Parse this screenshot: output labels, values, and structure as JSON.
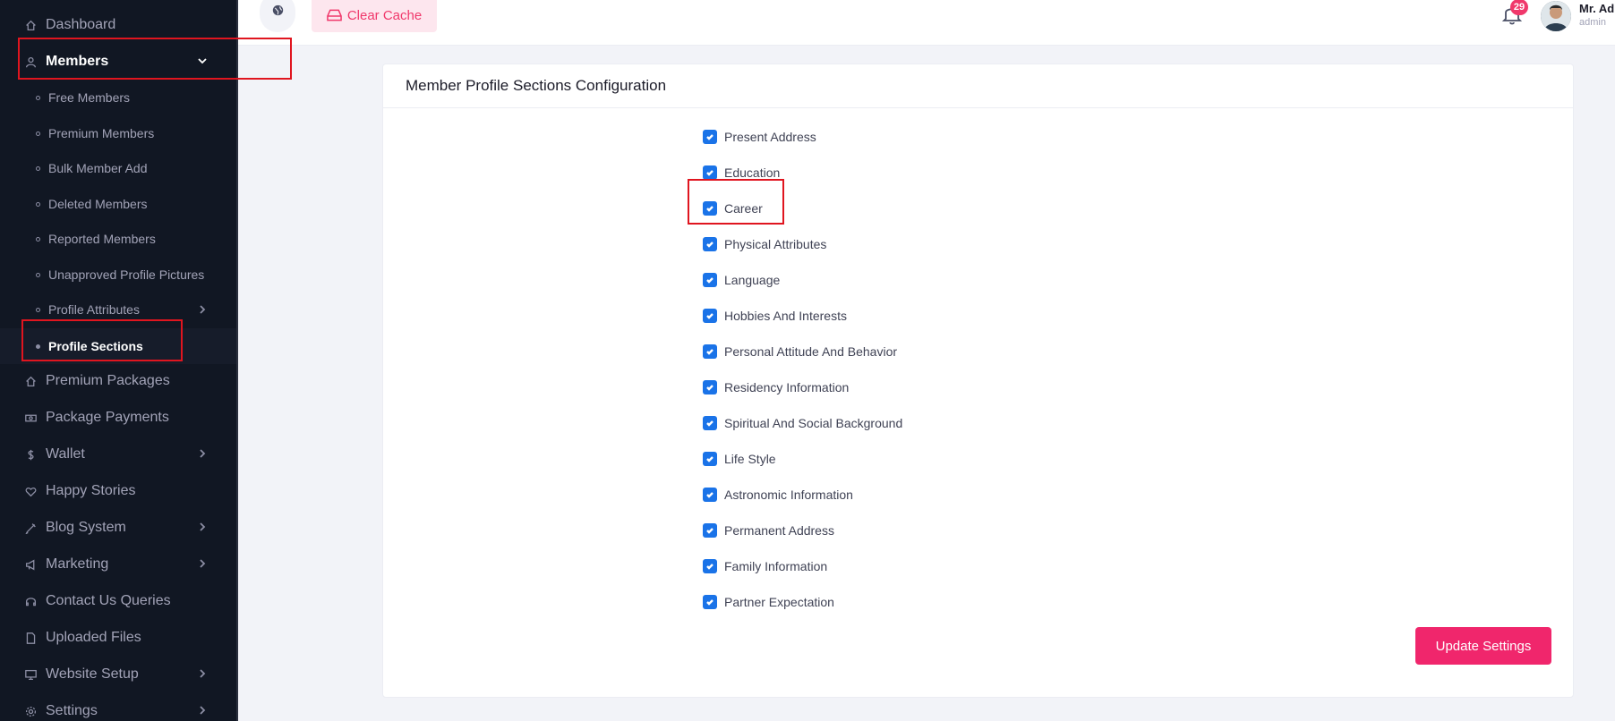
{
  "sidebar": {
    "items": [
      {
        "label": "Dashboard",
        "icon": "home-icon"
      },
      {
        "label": "Members",
        "icon": "user-icon"
      },
      {
        "label": "Premium Packages",
        "icon": "home-icon"
      },
      {
        "label": "Package Payments",
        "icon": "money-icon"
      },
      {
        "label": "Wallet",
        "icon": "dollar-icon"
      },
      {
        "label": "Happy Stories",
        "icon": "heart-icon"
      },
      {
        "label": "Blog System",
        "icon": "blog-icon"
      },
      {
        "label": "Marketing",
        "icon": "megaphone-icon"
      },
      {
        "label": "Contact Us Queries",
        "icon": "headset-icon"
      },
      {
        "label": "Uploaded Files",
        "icon": "file-icon"
      },
      {
        "label": "Website Setup",
        "icon": "monitor-icon"
      },
      {
        "label": "Settings",
        "icon": "gear-icon"
      }
    ],
    "members_submenu": [
      "Free Members",
      "Premium Members",
      "Bulk Member Add",
      "Deleted Members",
      "Reported Members",
      "Unapproved Profile Pictures",
      "Profile Attributes",
      "Profile Sections"
    ]
  },
  "topbar": {
    "clear_cache_label": "Clear Cache",
    "notification_count": "29",
    "user_name": "Mr. Ad",
    "user_role": "admin"
  },
  "card": {
    "title": "Member Profile Sections Configuration",
    "sections": [
      {
        "label": "Present Address",
        "checked": true
      },
      {
        "label": "Education",
        "checked": true
      },
      {
        "label": "Career",
        "checked": true
      },
      {
        "label": "Physical Attributes",
        "checked": true
      },
      {
        "label": "Language",
        "checked": true
      },
      {
        "label": "Hobbies And Interests",
        "checked": true
      },
      {
        "label": "Personal Attitude And Behavior",
        "checked": true
      },
      {
        "label": "Residency Information",
        "checked": true
      },
      {
        "label": "Spiritual And Social Background",
        "checked": true
      },
      {
        "label": "Life Style",
        "checked": true
      },
      {
        "label": "Astronomic Information",
        "checked": true
      },
      {
        "label": "Permanent Address",
        "checked": true
      },
      {
        "label": "Family Information",
        "checked": true
      },
      {
        "label": "Partner Expectation",
        "checked": true
      }
    ],
    "update_label": "Update Settings"
  },
  "colors": {
    "sidebar_bg": "#111723",
    "accent_pink": "#f0266c",
    "checkbox_blue": "#1a73e8",
    "annotation_red": "#e0151f"
  }
}
